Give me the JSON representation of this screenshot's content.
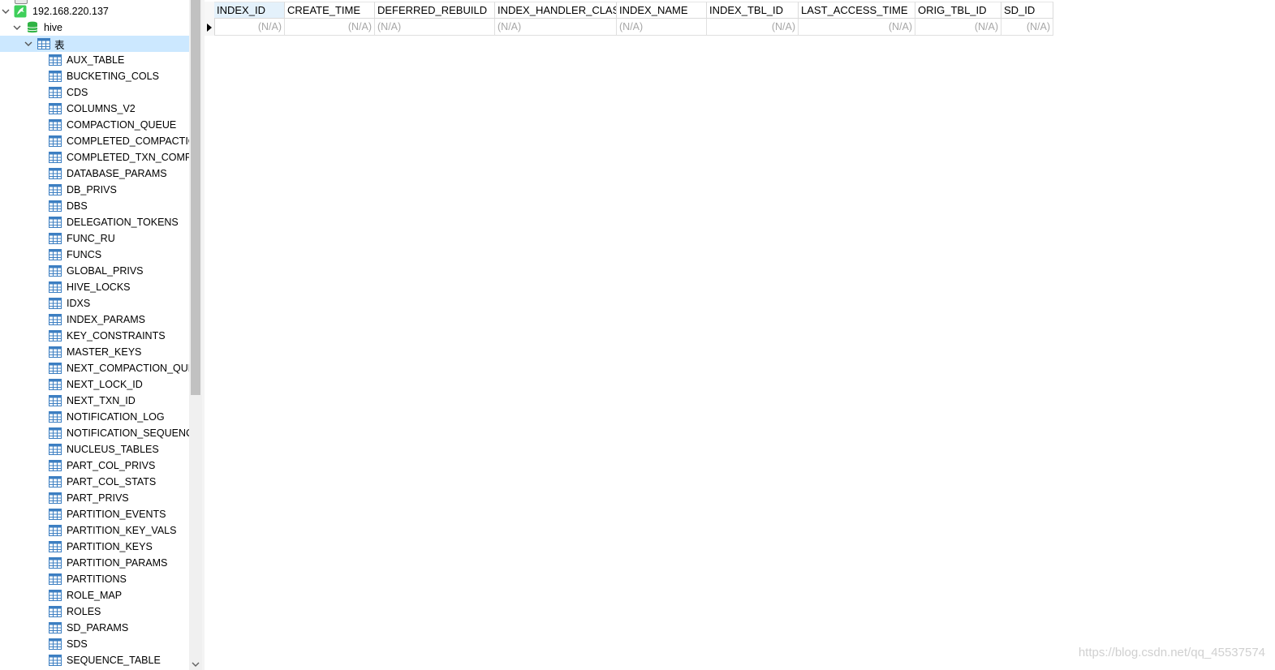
{
  "navigator": {
    "connection": "192.168.220.137",
    "database": "hive",
    "tables_group": "表",
    "tables": [
      "AUX_TABLE",
      "BUCKETING_COLS",
      "CDS",
      "COLUMNS_V2",
      "COMPACTION_QUEUE",
      "COMPLETED_COMPACTIONS",
      "COMPLETED_TXN_COMPONENTS",
      "DATABASE_PARAMS",
      "DB_PRIVS",
      "DBS",
      "DELEGATION_TOKENS",
      "FUNC_RU",
      "FUNCS",
      "GLOBAL_PRIVS",
      "HIVE_LOCKS",
      "IDXS",
      "INDEX_PARAMS",
      "KEY_CONSTRAINTS",
      "MASTER_KEYS",
      "NEXT_COMPACTION_QUEUE_ID",
      "NEXT_LOCK_ID",
      "NEXT_TXN_ID",
      "NOTIFICATION_LOG",
      "NOTIFICATION_SEQUENCE",
      "NUCLEUS_TABLES",
      "PART_COL_PRIVS",
      "PART_COL_STATS",
      "PART_PRIVS",
      "PARTITION_EVENTS",
      "PARTITION_KEY_VALS",
      "PARTITION_KEYS",
      "PARTITION_PARAMS",
      "PARTITIONS",
      "ROLE_MAP",
      "ROLES",
      "SD_PARAMS",
      "SDS",
      "SEQUENCE_TABLE"
    ]
  },
  "grid": {
    "columns": [
      "INDEX_ID",
      "CREATE_TIME",
      "DEFERRED_REBUILD",
      "INDEX_HANDLER_CLASS",
      "INDEX_NAME",
      "INDEX_TBL_ID",
      "LAST_ACCESS_TIME",
      "ORIG_TBL_ID",
      "SD_ID"
    ],
    "rows": [
      [
        "(N/A)",
        "(N/A)",
        "(N/A)",
        "(N/A)",
        "(N/A)",
        "(N/A)",
        "(N/A)",
        "(N/A)",
        "(N/A)"
      ]
    ]
  },
  "watermark": "https://blog.csdn.net/qq_45537574",
  "colors": {
    "selection": "#cce8ff",
    "active_header": "#e4f1fb",
    "null_text": "#a6a6a6",
    "connection_icon": "#3ecf5a",
    "database_icon": "#2fb344",
    "table_icon": "#3d7fc2"
  }
}
